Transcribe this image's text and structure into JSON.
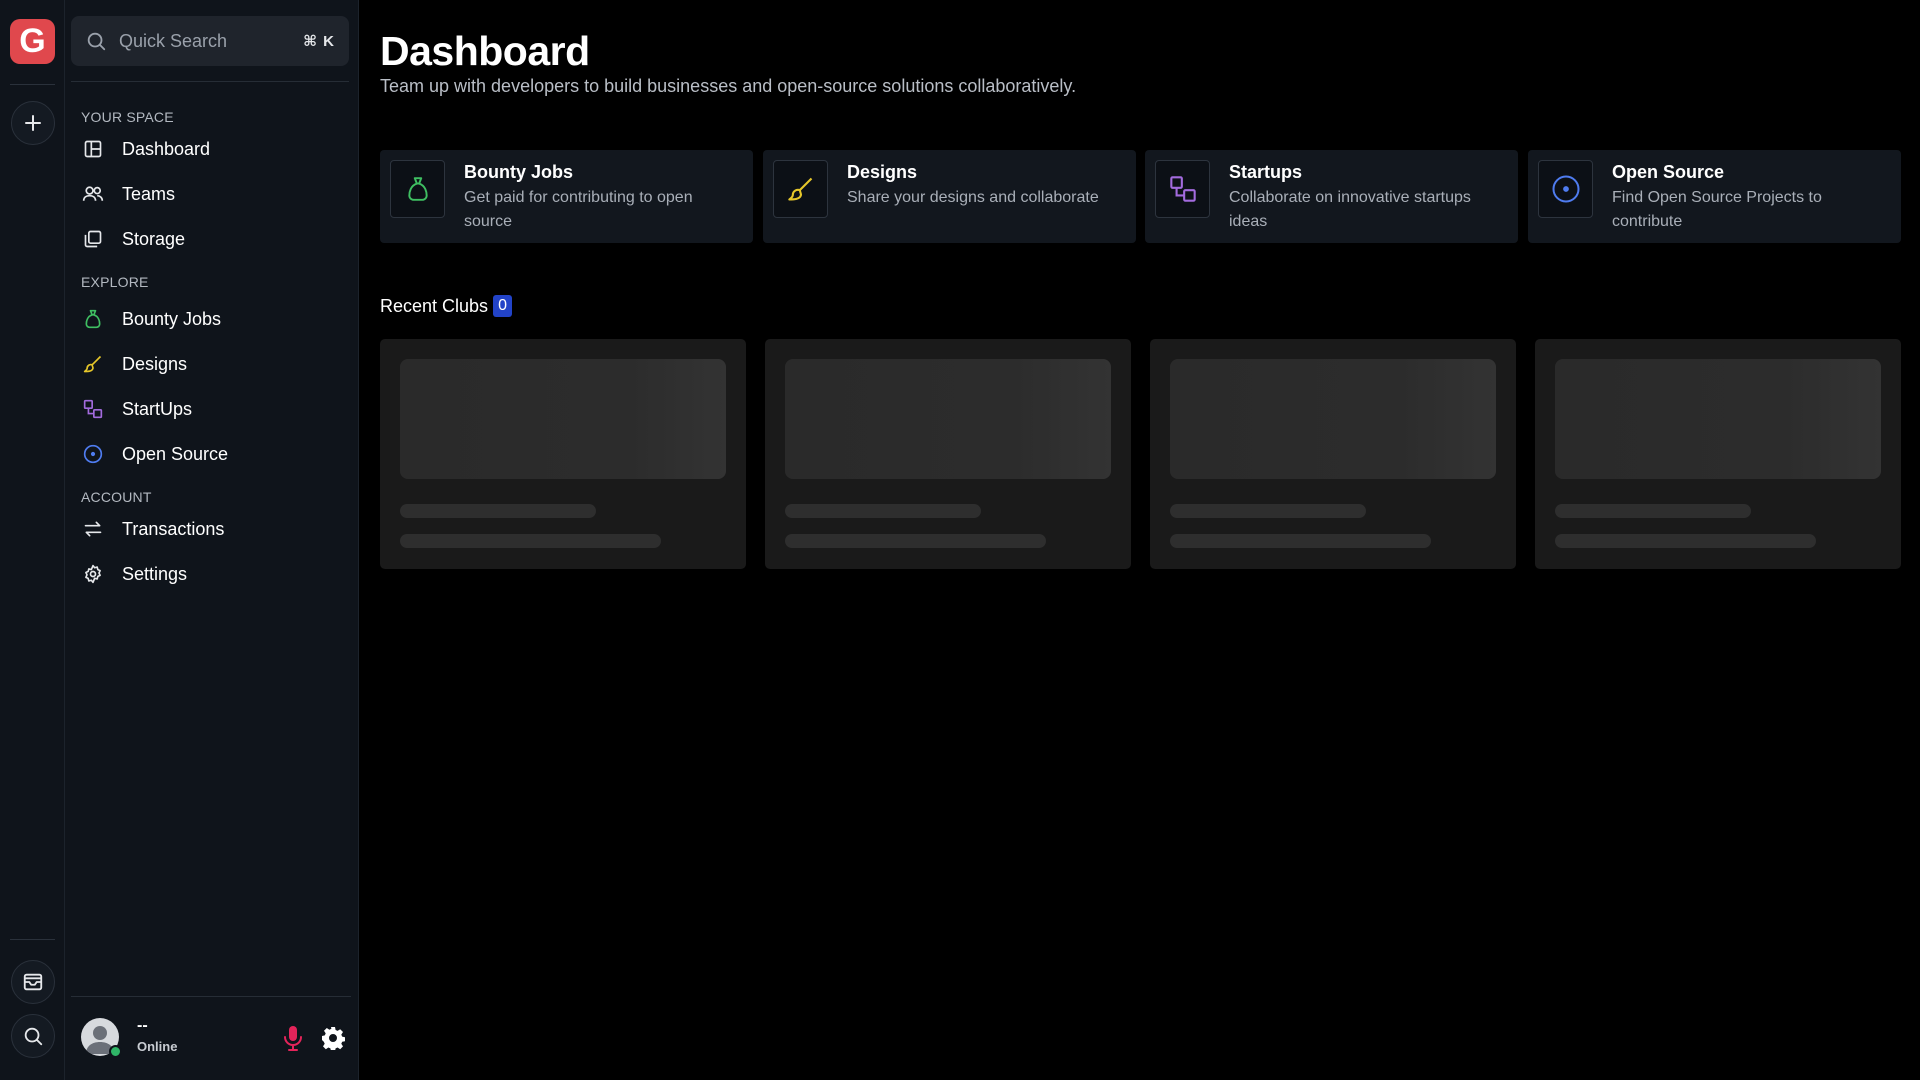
{
  "app": {
    "logo_letter": "G",
    "brand_color": "#e0484d"
  },
  "search": {
    "placeholder": "Quick Search",
    "shortcut": "⌘ K"
  },
  "sidebar": {
    "sections": [
      {
        "label": "YOUR SPACE",
        "items": [
          {
            "label": "Dashboard",
            "icon": "layout-icon"
          },
          {
            "label": "Teams",
            "icon": "users-icon"
          },
          {
            "label": "Storage",
            "icon": "storage-icon"
          }
        ]
      },
      {
        "label": "EXPLORE",
        "items": [
          {
            "label": "Bounty Jobs",
            "icon": "money-bag-icon"
          },
          {
            "label": "Designs",
            "icon": "brush-icon"
          },
          {
            "label": "StartUps",
            "icon": "startup-icon"
          },
          {
            "label": "Open Source",
            "icon": "open-source-icon"
          }
        ]
      },
      {
        "label": "ACCOUNT",
        "items": [
          {
            "label": "Transactions",
            "icon": "transfer-icon"
          },
          {
            "label": "Settings",
            "icon": "settings-icon"
          }
        ]
      }
    ]
  },
  "user": {
    "name": "--",
    "status": "Online"
  },
  "main": {
    "title": "Dashboard",
    "subtitle": "Team up with developers to build businesses and open-source solutions collaboratively.",
    "feature_cards": [
      {
        "title": "Bounty Jobs",
        "description": "Get paid for contributing to open source",
        "icon": "money-bag-icon",
        "color": "#3fbf62"
      },
      {
        "title": "Designs",
        "description": "Share your designs and collaborate",
        "icon": "brush-icon",
        "color": "#e6c72a"
      },
      {
        "title": "Startups",
        "description": "Collaborate on innovative startups ideas",
        "icon": "startup-icon",
        "color": "#a36bde"
      },
      {
        "title": "Open Source",
        "description": "Find Open Source Projects to contribute",
        "icon": "open-source-icon",
        "color": "#4f7cf0"
      }
    ],
    "recent_clubs": {
      "label": "Recent Clubs",
      "count": "0"
    }
  }
}
